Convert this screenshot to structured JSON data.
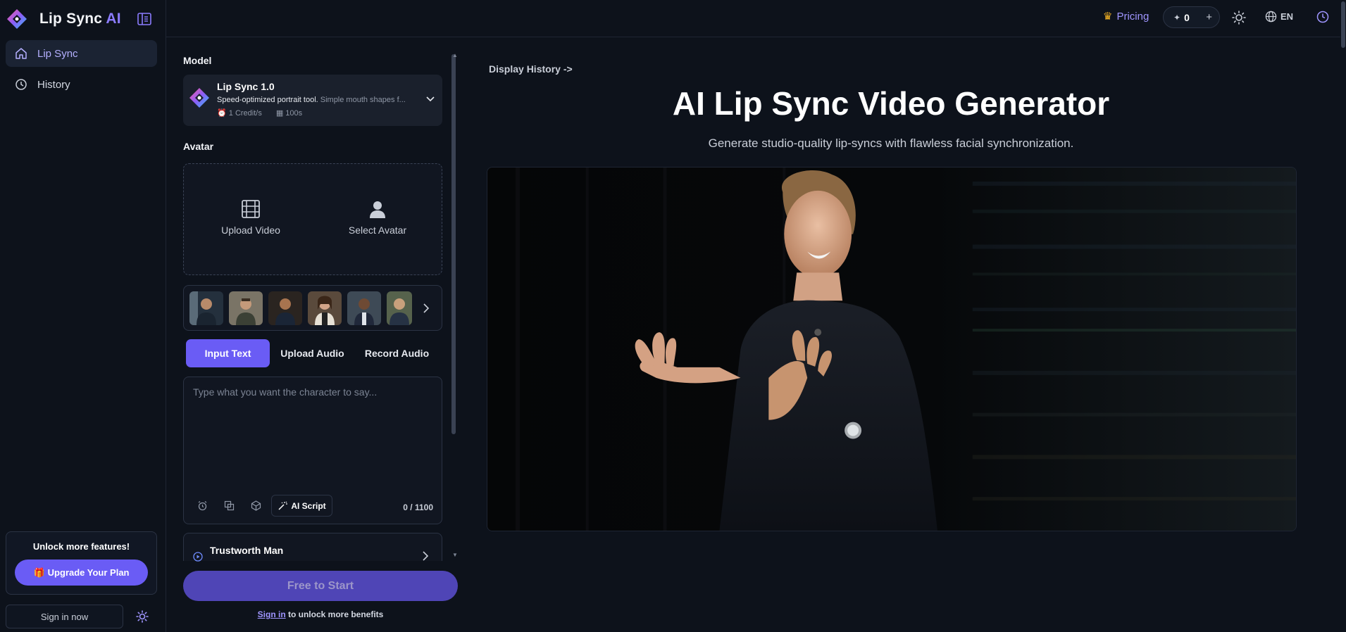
{
  "brand": {
    "name": "Lip Sync",
    "name_ai": "AI"
  },
  "sidebar": {
    "items": [
      {
        "label": "Lip Sync",
        "icon": "home-icon",
        "active": true
      },
      {
        "label": "History",
        "icon": "clock-icon",
        "active": false
      }
    ],
    "promo_title": "Unlock more features!",
    "upgrade_label": "Upgrade Your Plan",
    "signin_label": "Sign in now"
  },
  "topbar": {
    "pricing_label": "Pricing",
    "credits": "0",
    "plus": "+",
    "language": "EN"
  },
  "form": {
    "model_label": "Model",
    "model": {
      "name": "Lip Sync 1.0",
      "desc_bold": "Speed-optimized portrait tool.",
      "desc_rest": "Simple mouth shapes f...",
      "credit": "1 Credit/s",
      "duration": "100s"
    },
    "avatar_label": "Avatar",
    "upload_video": "Upload Video",
    "select_avatar": "Select Avatar",
    "tabs": [
      "Input Text",
      "Upload Audio",
      "Record Audio"
    ],
    "text_placeholder": "Type what you want the character to say...",
    "ai_script": "AI Script",
    "char_count": "0 / 1100",
    "voice_name": "Trustworth Man",
    "start_label": "Free to Start",
    "signin_link": "Sign in",
    "signin_rest": " to unlock more benefits"
  },
  "main": {
    "display_history": "Display History ->",
    "title": "AI Lip Sync Video Generator",
    "subtitle": "Generate studio-quality lip-syncs with flawless facial synchronization."
  },
  "colors": {
    "accent": "#6a5cf5",
    "bg": "#0d121b",
    "card": "#1a202c"
  }
}
